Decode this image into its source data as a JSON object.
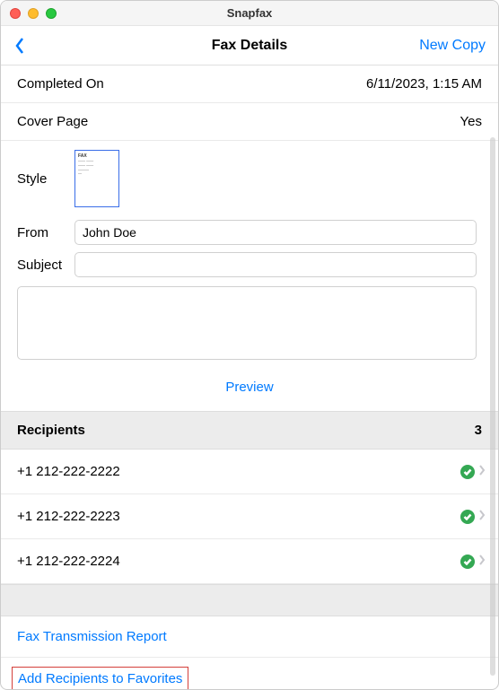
{
  "window": {
    "title": "Snapfax"
  },
  "nav": {
    "title": "Fax Details",
    "new_copy": "New Copy"
  },
  "completed": {
    "label": "Completed On",
    "value": "6/11/2023, 1:15 AM"
  },
  "cover": {
    "label": "Cover Page",
    "value": "Yes"
  },
  "style": {
    "label": "Style",
    "thumb_header": "FAX"
  },
  "from": {
    "label": "From",
    "value": "John Doe"
  },
  "subject": {
    "label": "Subject",
    "value": ""
  },
  "preview": {
    "label": "Preview"
  },
  "recipients": {
    "header": "Recipients",
    "count": "3",
    "items": [
      {
        "number": "+1 212-222-2222"
      },
      {
        "number": "+1 212-222-2223"
      },
      {
        "number": "+1 212-222-2224"
      }
    ]
  },
  "links": {
    "report": "Fax Transmission Report",
    "favorites": "Add Recipients to Favorites"
  }
}
